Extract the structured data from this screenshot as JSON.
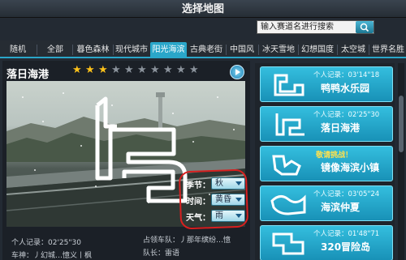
{
  "window": {
    "title": "选择地图"
  },
  "search": {
    "placeholder": "输入赛道名进行搜索"
  },
  "tabs": [
    {
      "label": "随机"
    },
    {
      "label": "全部"
    },
    {
      "label": "暮色森林"
    },
    {
      "label": "现代城市"
    },
    {
      "label": "阳光海滨",
      "active": true
    },
    {
      "label": "古典老街"
    },
    {
      "label": "中国风"
    },
    {
      "label": "冰天雪地"
    },
    {
      "label": "幻想国度"
    },
    {
      "label": "太空城"
    },
    {
      "label": "世界名胜"
    }
  ],
  "selected_map": {
    "name": "落日海港",
    "difficulty_stars": 3,
    "max_stars": 10
  },
  "options": {
    "season": {
      "label": "季节：",
      "value": "秋"
    },
    "time": {
      "label": "时间：",
      "value": "黄昏"
    },
    "weather": {
      "label": "天气：",
      "value": "雨"
    }
  },
  "info": {
    "record": "个人记录：02'25\"30",
    "car": "车神：丿幻城…憶义丨枫",
    "team": "占领车队：丿那年缤纷…憶",
    "team_sub": "队长：雷语"
  },
  "map_list": [
    {
      "record": "个人记录：03'14\"18",
      "name": "鸭鸭水乐园"
    },
    {
      "record": "个人记录：02'25\"30",
      "name": "落日海港"
    },
    {
      "challenge": "敬请挑战！",
      "name": "镜像海滨小镇"
    },
    {
      "record": "个人记录：03'05\"24",
      "name": "海滨仲夏"
    },
    {
      "record": "个人记录：01'48\"71",
      "name": "320冒险岛"
    }
  ],
  "colors": {
    "accent": "#2aa6c9",
    "star_on": "#ffc21a",
    "star_off": "#8a929b",
    "highlight_ring": "#d81f1f"
  }
}
